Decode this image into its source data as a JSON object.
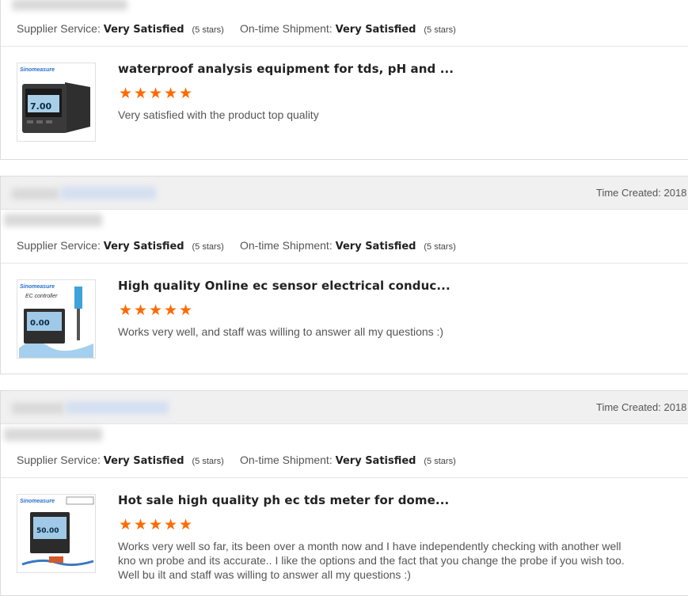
{
  "reviews": [
    {
      "time_created": "",
      "supplier_service_label": "Supplier Service:",
      "supplier_service_value": "Very Satisfied",
      "supplier_service_stars": "(5 stars)",
      "shipment_label": "On-time Shipment:",
      "shipment_value": "Very Satisfied",
      "shipment_stars": "(5 stars)",
      "product_title": "waterproof analysis equipment for tds, pH and ...",
      "rating": 5,
      "comment": "Very satisfied with the product top quality",
      "thumb": {
        "brand": "Sinomeasure",
        "display": "7.00"
      }
    },
    {
      "time_created": "Time Created: 2018",
      "supplier_service_label": "Supplier Service:",
      "supplier_service_value": "Very Satisfied",
      "supplier_service_stars": "(5 stars)",
      "shipment_label": "On-time Shipment:",
      "shipment_value": "Very Satisfied",
      "shipment_stars": "(5 stars)",
      "product_title": "High quality Online ec sensor electrical conduc...",
      "rating": 5,
      "comment": "Works very well, and staff was willing to answer all my questions :)",
      "thumb": {
        "brand": "Sinomeasure",
        "caption": "EC controller",
        "display": "0.00"
      }
    },
    {
      "time_created": "Time Created: 2018",
      "supplier_service_label": "Supplier Service:",
      "supplier_service_value": "Very Satisfied",
      "supplier_service_stars": "(5 stars)",
      "shipment_label": "On-time Shipment:",
      "shipment_value": "Very Satisfied",
      "shipment_stars": "(5 stars)",
      "product_title": "Hot sale high quality ph ec tds meter for dome...",
      "rating": 5,
      "comment": "Works very well so far, its been over a month now and I have independently checking with another well kno wn probe and its accurate.. I like the options and the fact that you change the probe if you wish too. Well bu ilt and staff was willing to answer all my questions :)",
      "thumb": {
        "brand": "Sinomeasure",
        "display": "50.00"
      }
    }
  ],
  "colors": {
    "star": "#ff6a00",
    "header_bg": "#f0f0f0"
  },
  "icons": {
    "star": "star-icon"
  }
}
